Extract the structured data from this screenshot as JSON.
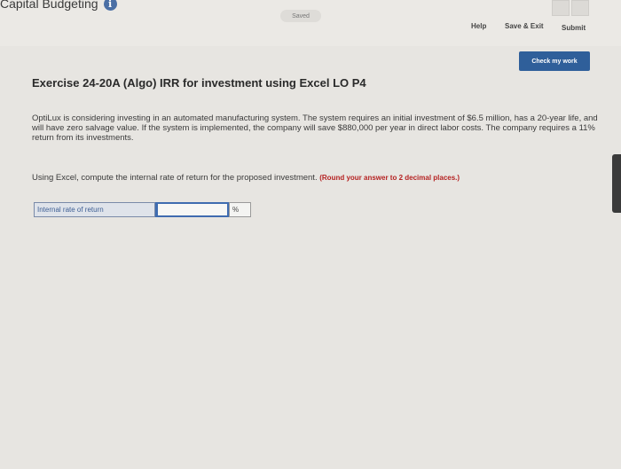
{
  "header": {
    "chapter_title": "Capital Budgeting",
    "status": "Saved",
    "help_label": "Help",
    "save_exit_label": "Save & Exit",
    "submit_label": "Submit"
  },
  "actions": {
    "check_my_work_label": "Check my work"
  },
  "exercise": {
    "title": "Exercise 24-20A (Algo) IRR for investment using Excel LO P4",
    "question_text": "OptiLux is considering investing in an automated manufacturing system. The system requires an initial investment of $6.5 million, has a 20-year life, and will have zero salvage value. If the system is implemented, the company will save $880,000 per year in direct labor costs. The company requires a 11% return from its investments.",
    "instruction_text": "Using Excel, compute the internal rate of return for the proposed investment.",
    "instruction_note": "(Round your answer to 2 decimal places.)"
  },
  "answer": {
    "label": "Internal rate of return",
    "value": "",
    "unit": "%"
  },
  "colors": {
    "accent": "#2f5f9a",
    "note_red": "#b52222"
  }
}
